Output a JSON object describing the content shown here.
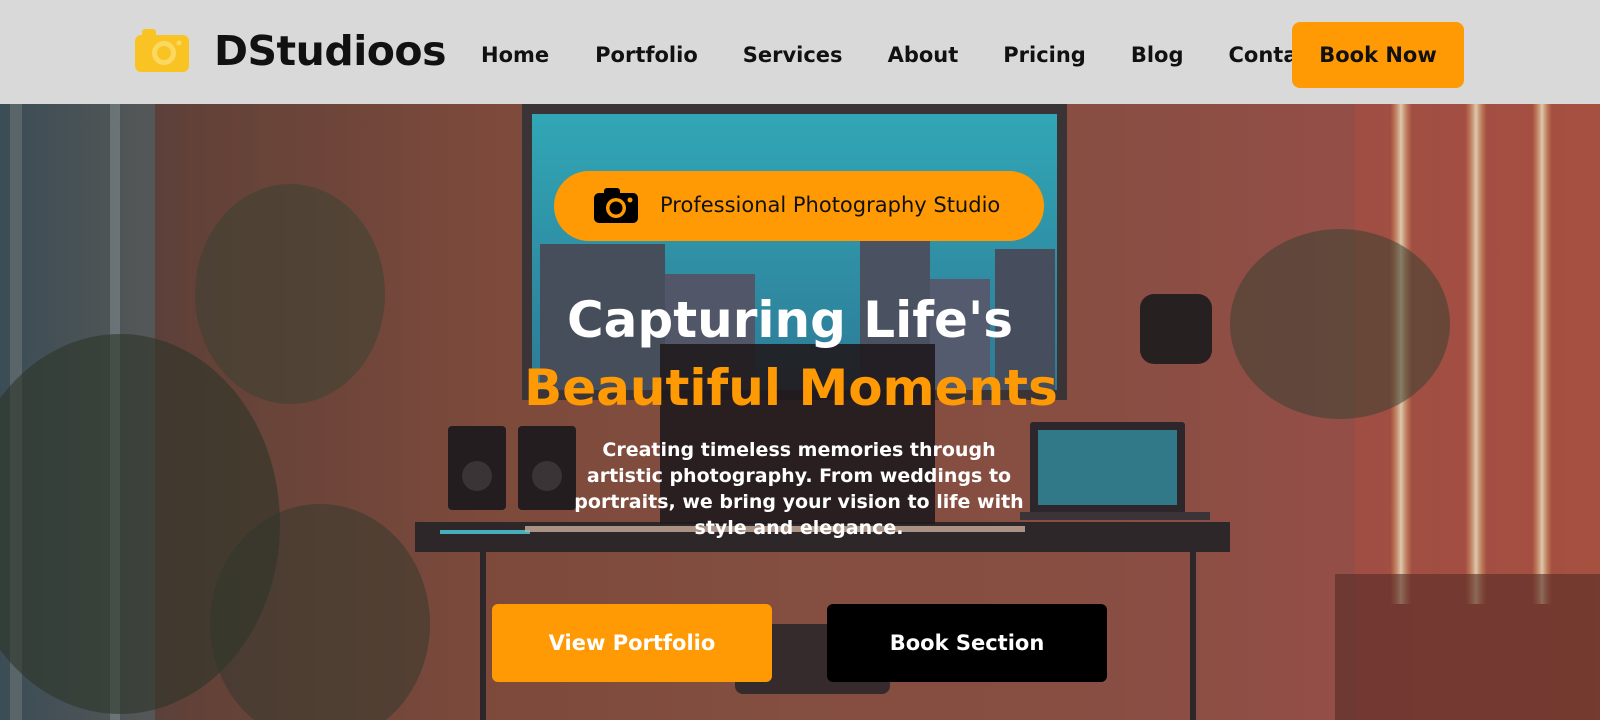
{
  "brand": {
    "name": "DStudioos",
    "logo_icon": "camera-icon",
    "accent": "#ff9a04"
  },
  "nav": {
    "items": [
      "Home",
      "Portfolio",
      "Services",
      "About",
      "Pricing",
      "Blog",
      "Contact"
    ],
    "cta": "Book Now"
  },
  "hero": {
    "badge": {
      "icon": "camera-icon",
      "text": "Professional Photography Studio"
    },
    "title_line1": "Capturing Life's",
    "title_line2": "Beautiful Moments",
    "subtitle": "Creating timeless memories through artistic photography. From weddings to portraits, we bring your vision to life with style and elegance.",
    "primary_button": "View Portfolio",
    "secondary_button": "Book Section"
  },
  "colors": {
    "header_bg": "#d9d9d9",
    "accent": "#ff9a04",
    "dark_button": "#000000",
    "text_dark": "#111111"
  }
}
